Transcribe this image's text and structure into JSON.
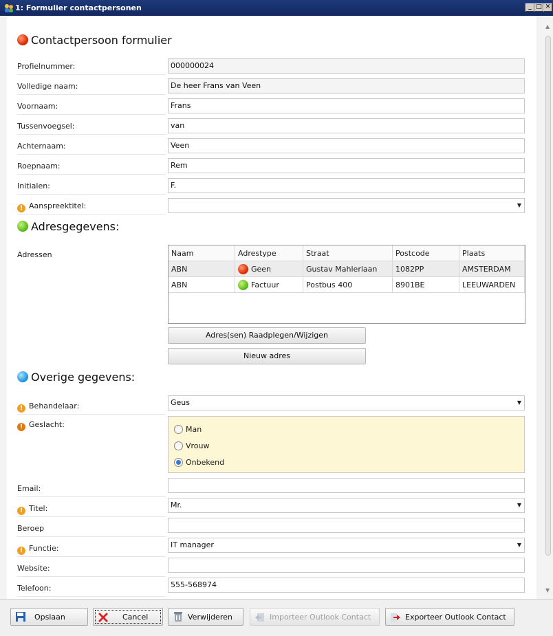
{
  "window": {
    "title": "1: Formulier contactpersonen"
  },
  "sections": {
    "contact": "Contactpersoon formulier",
    "address": "Adresgegevens:",
    "other": "Overige gegevens:"
  },
  "contact_fields": {
    "profielnummer": {
      "label": "Profielnummer:",
      "value": "000000024"
    },
    "volledige_naam": {
      "label": "Volledige naam:",
      "value": "De heer Frans van Veen"
    },
    "voornaam": {
      "label": "Voornaam:",
      "value": "Frans"
    },
    "tussenvoegsel": {
      "label": "Tussenvoegsel:",
      "value": "van"
    },
    "achternaam": {
      "label": "Achternaam:",
      "value": "Veen"
    },
    "roepnaam": {
      "label": "Roepnaam:",
      "value": "Rem"
    },
    "initialen": {
      "label": "Initialen:",
      "value": "F."
    },
    "aanspreektitel": {
      "label": "Aanspreektitel:",
      "value": ""
    }
  },
  "addresses": {
    "label": "Adressen",
    "columns": [
      "Naam",
      "Adrestype",
      "Straat",
      "Postcode",
      "Plaats"
    ],
    "rows": [
      {
        "naam": "ABN",
        "adrestype": "Geen",
        "status": "red",
        "straat": "Gustav Mahlerlaan",
        "postcode": "1082PP",
        "plaats": "AMSTERDAM"
      },
      {
        "naam": "ABN",
        "adrestype": "Factuur",
        "status": "green",
        "straat": "Postbus 400",
        "postcode": "8901BE",
        "plaats": "LEEUWARDEN"
      }
    ],
    "view_button": "Adres(sen) Raadplegen/Wijzigen",
    "new_button": "Nieuw adres"
  },
  "other_fields": {
    "behandelaar": {
      "label": "Behandelaar:",
      "value": "Geus"
    },
    "geslacht": {
      "label": "Geslacht:",
      "options": [
        "Man",
        "Vrouw",
        "Onbekend"
      ],
      "selected": "Onbekend"
    },
    "email": {
      "label": "Email:",
      "value": ""
    },
    "titel": {
      "label": "Titel:",
      "value": "Mr."
    },
    "beroep": {
      "label": "Beroep",
      "value": ""
    },
    "functie": {
      "label": "Functie:",
      "value": "IT manager"
    },
    "website": {
      "label": "Website:",
      "value": ""
    },
    "telefoon": {
      "label": "Telefoon:",
      "value": "555-568974"
    }
  },
  "footer": {
    "save": "Opslaan",
    "cancel": "Cancel",
    "delete": "Verwijderen",
    "import": "Importeer Outlook Contact",
    "export": "Exporteer Outlook Contact"
  },
  "colors": {
    "titlebar": "#1f3a7a",
    "status_red": "#e03000",
    "status_green": "#60c020",
    "status_blue": "#2a9be0",
    "warning": "#f0a020",
    "radio_panel": "#fdf7d6"
  }
}
